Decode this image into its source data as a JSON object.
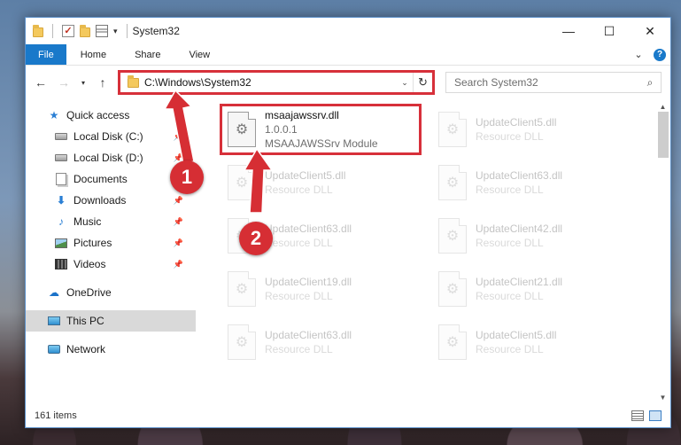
{
  "window": {
    "title": "System32",
    "controls": [
      "—",
      "☐",
      "✕"
    ]
  },
  "ribbon": {
    "tabs": [
      "File",
      "Home",
      "Share",
      "View"
    ]
  },
  "nav": {
    "address_path": "C:\\Windows\\System32",
    "search_placeholder": "Search System32"
  },
  "sidebar": {
    "items": [
      {
        "label": "Quick access",
        "icon": "star-icon",
        "pinned": false
      },
      {
        "label": "Local Disk (C:)",
        "icon": "disk-icon",
        "pinned": true
      },
      {
        "label": "Local Disk (D:)",
        "icon": "disk-icon",
        "pinned": true
      },
      {
        "label": "Documents",
        "icon": "documents-icon",
        "pinned": true
      },
      {
        "label": "Downloads",
        "icon": "download-icon",
        "pinned": true
      },
      {
        "label": "Music",
        "icon": "music-icon",
        "pinned": true
      },
      {
        "label": "Pictures",
        "icon": "pictures-icon",
        "pinned": true
      },
      {
        "label": "Videos",
        "icon": "videos-icon",
        "pinned": true
      },
      {
        "label": "OneDrive",
        "icon": "cloud-icon",
        "pinned": false
      },
      {
        "label": "This PC",
        "icon": "pc-icon",
        "pinned": false,
        "selected": true
      },
      {
        "label": "Network",
        "icon": "network-icon",
        "pinned": false
      }
    ]
  },
  "files": [
    {
      "name": "msaajawssrv.dll",
      "version": "1.0.0.1",
      "description": "MSAAJAWSSrv Module",
      "highlighted": true
    },
    {
      "name": "UpdateClient5.dll",
      "description": "Resource DLL"
    },
    {
      "name": "UpdateClient5.dll",
      "description": "Resource DLL"
    },
    {
      "name": "UpdateClient63.dll",
      "description": "Resource DLL"
    },
    {
      "name": "UpdateClient63.dll",
      "description": "Resource DLL"
    },
    {
      "name": "UpdateClient42.dll",
      "description": "Resource DLL"
    },
    {
      "name": "UpdateClient19.dll",
      "description": "Resource DLL"
    },
    {
      "name": "UpdateClient21.dll",
      "description": "Resource DLL"
    },
    {
      "name": "UpdateClient63.dll",
      "description": "Resource DLL"
    },
    {
      "name": "UpdateClient5.dll",
      "description": "Resource DLL"
    }
  ],
  "status": {
    "item_count": "161 items"
  },
  "callouts": {
    "one": "1",
    "two": "2"
  },
  "colors": {
    "accent": "#1979ca",
    "highlight": "#d7303a",
    "badge": "#d62e34"
  }
}
